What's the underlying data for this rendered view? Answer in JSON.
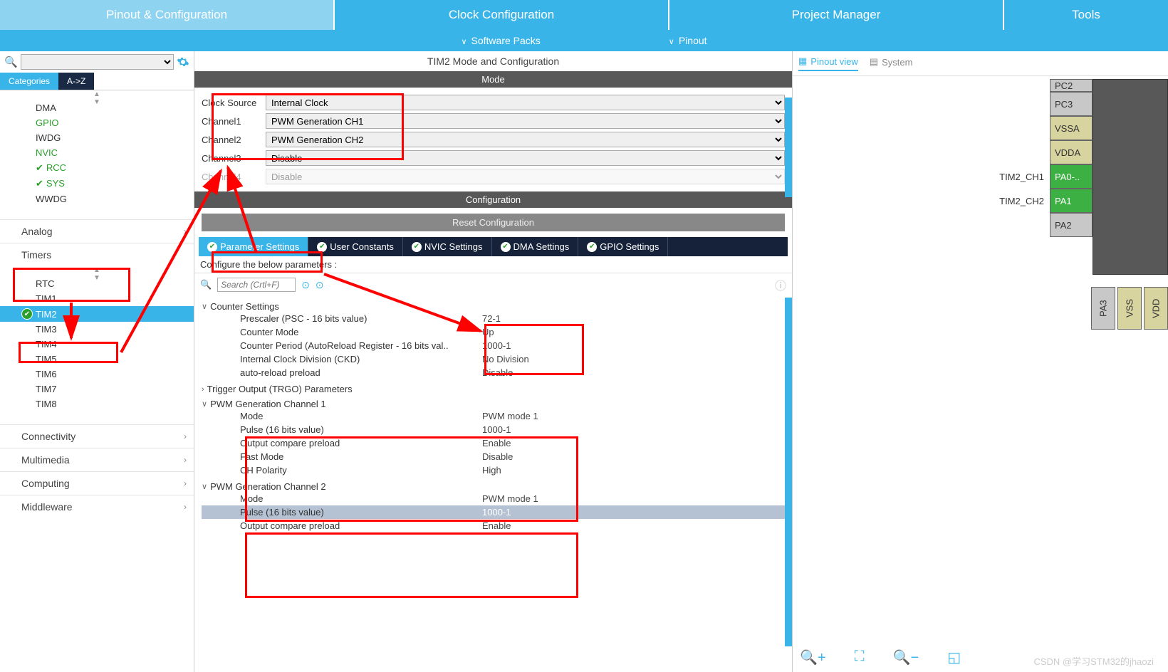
{
  "topnav": {
    "tabs": [
      "Pinout & Configuration",
      "Clock Configuration",
      "Project Manager",
      "Tools"
    ],
    "active": 0
  },
  "subnav": {
    "packs": "Software Packs",
    "pinout": "Pinout"
  },
  "left": {
    "tabs": {
      "cat": "Categories",
      "az": "A->Z"
    },
    "items_top": [
      {
        "label": "DMA",
        "green": false,
        "chk": false
      },
      {
        "label": "GPIO",
        "green": true,
        "chk": false
      },
      {
        "label": "IWDG",
        "green": false,
        "chk": false
      },
      {
        "label": "NVIC",
        "green": true,
        "chk": false
      },
      {
        "label": "RCC",
        "green": true,
        "chk": true
      },
      {
        "label": "SYS",
        "green": true,
        "chk": true
      },
      {
        "label": "WWDG",
        "green": false,
        "chk": false
      }
    ],
    "groups": [
      {
        "label": "Analog"
      },
      {
        "label": "Timers"
      }
    ],
    "timers": [
      "RTC",
      "TIM1",
      "TIM2",
      "TIM3",
      "TIM4",
      "TIM5",
      "TIM6",
      "TIM7",
      "TIM8"
    ],
    "groups2": [
      {
        "label": "Connectivity"
      },
      {
        "label": "Multimedia"
      },
      {
        "label": "Computing"
      },
      {
        "label": "Middleware"
      }
    ]
  },
  "center": {
    "title": "TIM2 Mode and Configuration",
    "mode_head": "Mode",
    "mode_rows": [
      {
        "label": "Clock Source",
        "val": "Internal Clock"
      },
      {
        "label": "Channel1",
        "val": "PWM Generation CH1"
      },
      {
        "label": "Channel2",
        "val": "PWM Generation CH2"
      },
      {
        "label": "Channel3",
        "val": "Disable"
      },
      {
        "label": "Channel4",
        "val": "Disable"
      }
    ],
    "cfg_head": "Configuration",
    "reset": "Reset Configuration",
    "subtabs": [
      "Parameter Settings",
      "User Constants",
      "NVIC Settings",
      "DMA Settings",
      "GPIO Settings"
    ],
    "instr": "Configure the below parameters :",
    "search_ph": "Search (Crtl+F)",
    "params": {
      "counter": {
        "title": "Counter Settings",
        "rows": [
          {
            "n": "Prescaler (PSC - 16 bits value)",
            "v": "72-1"
          },
          {
            "n": "Counter Mode",
            "v": "Up"
          },
          {
            "n": "Counter Period (AutoReload Register - 16 bits val..",
            "v": "1000-1"
          },
          {
            "n": "Internal Clock Division (CKD)",
            "v": "No Division"
          },
          {
            "n": "auto-reload preload",
            "v": "Disable"
          }
        ]
      },
      "trgo": {
        "title": "Trigger Output (TRGO) Parameters"
      },
      "pwm1": {
        "title": "PWM Generation Channel 1",
        "rows": [
          {
            "n": "Mode",
            "v": "PWM mode 1"
          },
          {
            "n": "Pulse (16 bits value)",
            "v": "1000-1"
          },
          {
            "n": "Output compare preload",
            "v": "Enable"
          },
          {
            "n": "Fast Mode",
            "v": "Disable"
          },
          {
            "n": "CH Polarity",
            "v": "High"
          }
        ]
      },
      "pwm2": {
        "title": "PWM Generation Channel 2",
        "rows": [
          {
            "n": "Mode",
            "v": "PWM mode 1"
          },
          {
            "n": "Pulse (16 bits value)",
            "v": "1000-1",
            "sel": true
          },
          {
            "n": "Output compare preload",
            "v": "Enable"
          }
        ]
      }
    }
  },
  "right": {
    "pinout_view": "Pinout view",
    "system_view": "System",
    "labels": {
      "ch1": "TIM2_CH1",
      "ch2": "TIM2_CH2"
    },
    "pins": [
      "PC2",
      "PC3",
      "VSSA",
      "VDDA",
      "PA0-..",
      "PA1",
      "PA2"
    ],
    "sidepins": [
      "PA3",
      "VSS",
      "VDD"
    ]
  },
  "watermark": "CSDN @学习STM32的jhaozi"
}
